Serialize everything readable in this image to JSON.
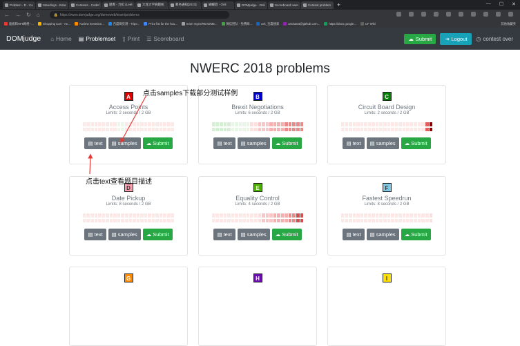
{
  "browser": {
    "tabs": [
      {
        "label": "Problem - D - Co"
      },
      {
        "label": "Standings - Educa"
      },
      {
        "label": "Contests - Codefo"
      },
      {
        "label": "题库 - 力扣 (LeetC"
      },
      {
        "label": "大连大学刷题统"
      },
      {
        "label": "教务通知[2023]"
      },
      {
        "label": "蝴蝶后 - Onli"
      },
      {
        "label": "DOMjudge - Onli"
      },
      {
        "label": "Scoreboard nwer"
      },
      {
        "label": "Contest problem"
      }
    ],
    "url": "https://www.domjudge.org/demoweb/team/problems",
    "bookmarks": [
      "面板和HF9网络 -...",
      "Shopping Cart - Ae...",
      "Aoview Invention...",
      "百度网页测 - Tripe...",
      "Price list for the hou...",
      "team regex/README...",
      "微信团队 - 免费网...",
      "cek_百度搜索",
      "assistant@github.com...",
      "https://docs.google...",
      "CF Wiki"
    ],
    "bookmarks_right": "其他收藏夹"
  },
  "navbar": {
    "brand": "DOMjudge",
    "links": [
      {
        "label": "Home",
        "icon": "home-icon"
      },
      {
        "label": "Problemset",
        "icon": "book-icon"
      },
      {
        "label": "Print",
        "icon": "file-icon"
      },
      {
        "label": "Scoreboard",
        "icon": "list-icon"
      }
    ],
    "submit_label": "Submit",
    "logout_label": "Logout",
    "status_label": "contest over"
  },
  "page": {
    "title": "NWERC 2018 problems"
  },
  "buttons": {
    "text_label": "text",
    "samples_label": "samples",
    "submit_label": "Submit"
  },
  "problems": [
    {
      "letter": "A",
      "name": "Access Points",
      "limits": "Limits: 2 seconds / 2 GB",
      "color": "#e00000",
      "heat": [
        "#fde8e8",
        "#fde8e8",
        "#fde8e8",
        "#fde8e8",
        "#fde8e8",
        "#fde8e8",
        "#fde8e8",
        "#fde8e8",
        "#fde8e8",
        "#ecf7ec",
        "#ecf7ec",
        "#fde8e8",
        "#fde8e8",
        "#fde8e8",
        "#fde8e8",
        "#fde8e8",
        "#fde8e8",
        "#fde8e8",
        "#fde8e8",
        "#fde8e8",
        "#fde8e8",
        "#fde8e8",
        "#fde8e8",
        "#fde8e8"
      ]
    },
    {
      "letter": "B",
      "name": "Brexit Negotiations",
      "limits": "Limits: 6 seconds / 2 GB",
      "color": "#0000cc",
      "heat": [
        "#d4efd4",
        "#d4efd4",
        "#d4efd4",
        "#d4efd4",
        "#d4efd4",
        "#e8f6e8",
        "#e8f6e8",
        "#e8f6e8",
        "#e8f6e8",
        "#e8f6e8",
        "#fbe0e0",
        "#fbe0e0",
        "#f7c6c6",
        "#f7c6c6",
        "#f7c6c6",
        "#f3b0b0",
        "#f3b0b0",
        "#f3b0b0",
        "#f3b0b0",
        "#e88a8a",
        "#e88a8a",
        "#e88a8a",
        "#e88a8a",
        "#e88a8a"
      ]
    },
    {
      "letter": "C",
      "name": "Circuit Board Design",
      "limits": "Limits: 2 seconds / 2 GB",
      "color": "#008000",
      "heat": [
        "#fde8e8",
        "#fde8e8",
        "#fde8e8",
        "#fde8e8",
        "#fde8e8",
        "#fde8e8",
        "#fde8e8",
        "#fde8e8",
        "#fde8e8",
        "#fde8e8",
        "#fde8e8",
        "#fde8e8",
        "#fde8e8",
        "#fde8e8",
        "#fde8e8",
        "#fde8e8",
        "#fde8e8",
        "#fde8e8",
        "#fde8e8",
        "#fde8e8",
        "#fde8e8",
        "#fde8e8",
        "#e06060",
        "#8b0000"
      ]
    },
    {
      "letter": "D",
      "name": "Date Pickup",
      "limits": "Limits: 8 seconds / 2 GB",
      "color": "#ff9fb0",
      "heat": [
        "#fde8e8",
        "#fde8e8",
        "#fde8e8",
        "#fde8e8",
        "#fde8e8",
        "#fde8e8",
        "#fde8e8",
        "#fde8e8",
        "#fde8e8",
        "#fde8e8",
        "#fde8e8",
        "#fde8e8",
        "#fde8e8",
        "#fde8e8",
        "#fde8e8",
        "#fde8e8",
        "#fde8e8",
        "#fde8e8",
        "#fde8e8",
        "#fde8e8",
        "#fde8e8",
        "#fde8e8",
        "#fde8e8",
        "#fde8e8"
      ]
    },
    {
      "letter": "E",
      "name": "Equality Control",
      "limits": "Limits: 4 seconds / 2 GB",
      "color": "#4caf00",
      "heat": [
        "#fde8e8",
        "#fde8e8",
        "#fde8e8",
        "#fde8e8",
        "#fde8e8",
        "#fde8e8",
        "#fde8e8",
        "#fde8e8",
        "#fde8e8",
        "#fde8e8",
        "#fde8e8",
        "#fde8e8",
        "#fbe0e0",
        "#f7c6c6",
        "#f7c6c6",
        "#f7c6c6",
        "#f3b0b0",
        "#f3b0b0",
        "#f3b0b0",
        "#f3b0b0",
        "#e88a8a",
        "#e88a8a",
        "#d05050",
        "#d05050"
      ]
    },
    {
      "letter": "F",
      "name": "Fastest Speedrun",
      "limits": "Limits: 8 seconds / 2 GB",
      "color": "#7ec8e3",
      "heat": [
        "#fde8e8",
        "#fde8e8",
        "#fde8e8",
        "#fde8e8",
        "#fde8e8",
        "#fde8e8",
        "#fde8e8",
        "#fde8e8",
        "#fde8e8",
        "#fde8e8",
        "#fde8e8",
        "#fde8e8",
        "#fde8e8",
        "#fde8e8",
        "#fde8e8",
        "#fde8e8",
        "#fde8e8",
        "#fde8e8",
        "#fde8e8",
        "#fde8e8",
        "#fde8e8",
        "#fde8e8",
        "#fde8e8",
        "#fbe0e0"
      ]
    },
    {
      "letter": "G",
      "name": "",
      "limits": "",
      "color": "#ff8c00",
      "heat": []
    },
    {
      "letter": "H",
      "name": "",
      "limits": "",
      "color": "#6a0dad",
      "heat": []
    },
    {
      "letter": "I",
      "name": "",
      "limits": "",
      "color": "#ffe000",
      "heat": []
    }
  ],
  "annotations": {
    "samples_note": "点击samples下载部分测试样例",
    "text_note": "点击text查看题目描述"
  }
}
